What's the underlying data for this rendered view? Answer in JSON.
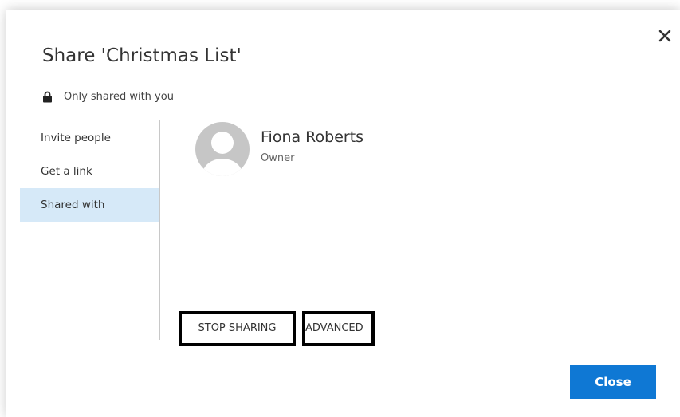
{
  "dialog": {
    "title": "Share 'Christmas List'",
    "privacy_text": "Only shared with you",
    "close_icon": "close-icon",
    "lock_icon": "lock-icon"
  },
  "nav": {
    "items": [
      {
        "label": "Invite people",
        "selected": false
      },
      {
        "label": "Get a link",
        "selected": false
      },
      {
        "label": "Shared with",
        "selected": true
      }
    ]
  },
  "person": {
    "name": "Fiona Roberts",
    "role": "Owner",
    "avatar_icon": "default-avatar-icon"
  },
  "actions": {
    "stop_sharing_label": "STOP SHARING",
    "advanced_label": "ADVANCED"
  },
  "footer": {
    "close_label": "Close"
  },
  "colors": {
    "accent": "#0f78d4",
    "nav_selected": "#d6e9f8",
    "avatar_bg": "#c6c6c6"
  }
}
